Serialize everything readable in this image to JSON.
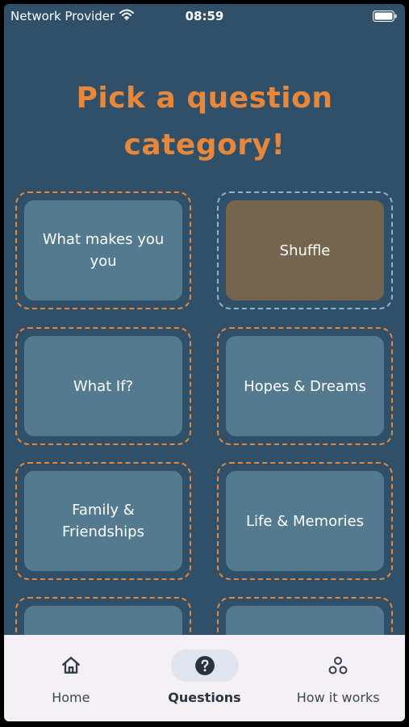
{
  "status_bar": {
    "carrier": "Network Provider",
    "time": "08:59"
  },
  "title": "Pick a question category!",
  "categories": [
    {
      "label": "What makes you you"
    },
    {
      "label": "Shuffle"
    },
    {
      "label": "What If?"
    },
    {
      "label": "Hopes & Dreams"
    },
    {
      "label": "Family & Friendships"
    },
    {
      "label": "Life & Memories"
    },
    {
      "label": ""
    },
    {
      "label": ""
    }
  ],
  "nav": {
    "items": [
      {
        "label": "Home",
        "icon": "home-icon"
      },
      {
        "label": "Questions",
        "icon": "question-circle-icon",
        "active": true
      },
      {
        "label": "How it works",
        "icon": "circles-icon"
      }
    ]
  },
  "colors": {
    "background": "#2f5068",
    "accent": "#e8873a",
    "card": "#547a8f",
    "shuffle_card": "#75654f",
    "nav_background": "#f4f0f6"
  }
}
